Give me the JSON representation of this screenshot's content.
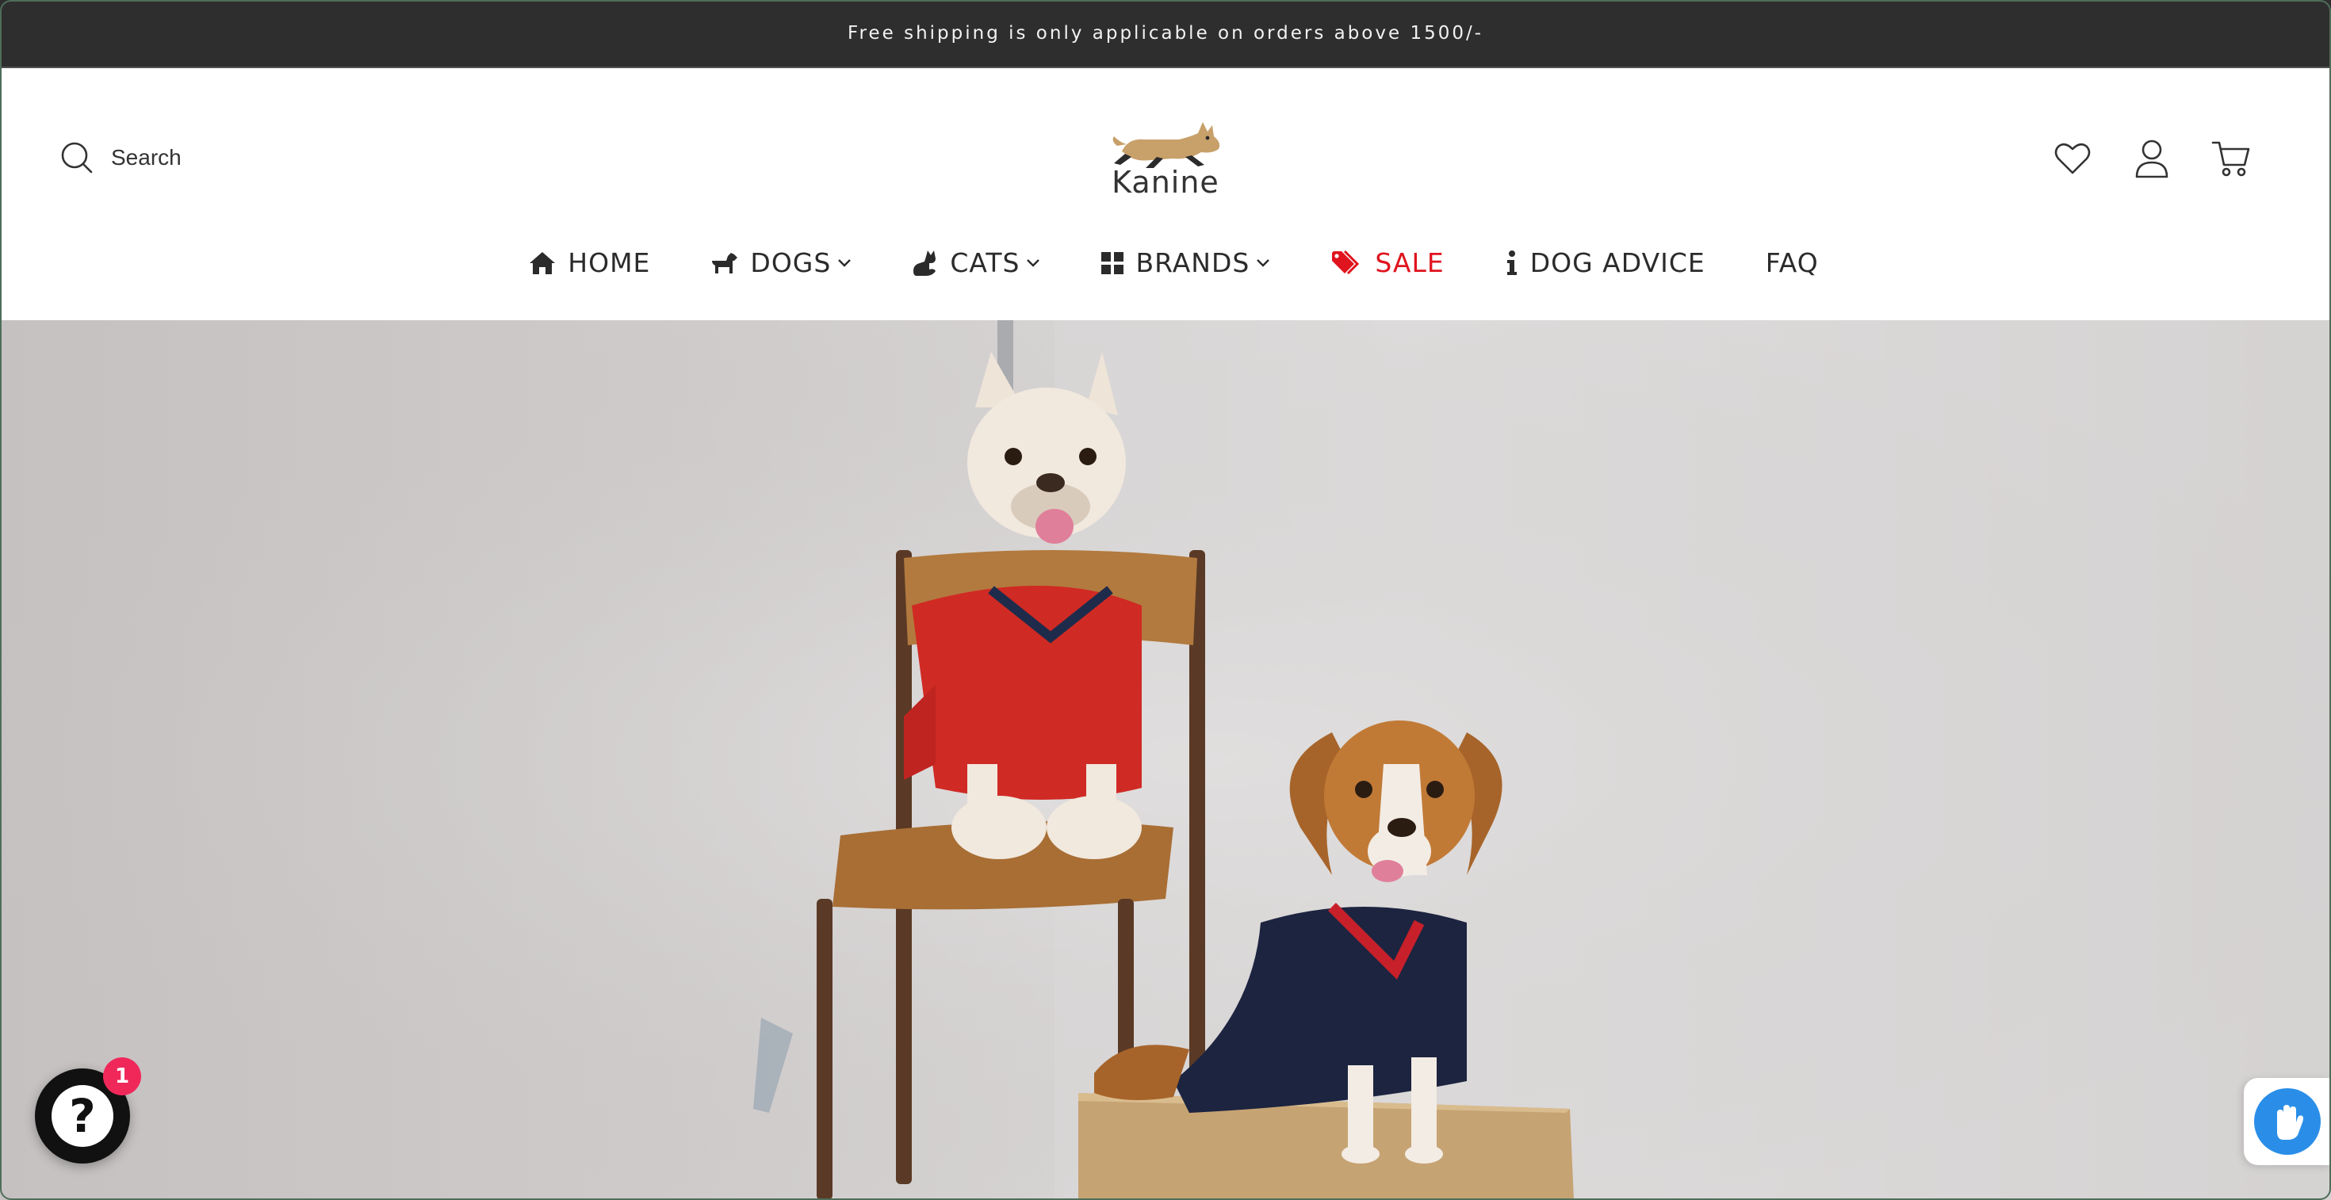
{
  "announcement": {
    "text": "Free shipping is only applicable on orders above 1500/-"
  },
  "search": {
    "label": "Search"
  },
  "logo": {
    "wordmark": "Kanine"
  },
  "header_actions": {
    "icons": [
      "heart-icon",
      "user-icon",
      "cart-icon"
    ]
  },
  "nav": {
    "items": [
      {
        "label": "HOME",
        "icon": "home-icon",
        "dropdown": false
      },
      {
        "label": "DOGS",
        "icon": "dog-icon",
        "dropdown": true
      },
      {
        "label": "CATS",
        "icon": "cat-icon",
        "dropdown": true
      },
      {
        "label": "BRANDS",
        "icon": "grid-icon",
        "dropdown": true
      },
      {
        "label": "SALE",
        "icon": "tag-icon",
        "dropdown": false
      },
      {
        "label": "DOG ADVICE",
        "icon": "info-icon",
        "dropdown": false
      },
      {
        "label": "FAQ",
        "dropdown": false
      }
    ]
  },
  "chat_widget": {
    "badge_count": "1",
    "glyph": "?"
  },
  "colors": {
    "announcement_bg": "#2e2e2e",
    "sale": "#e0141e",
    "badge": "#f0285a",
    "accessibility": "#2a8ee8"
  }
}
